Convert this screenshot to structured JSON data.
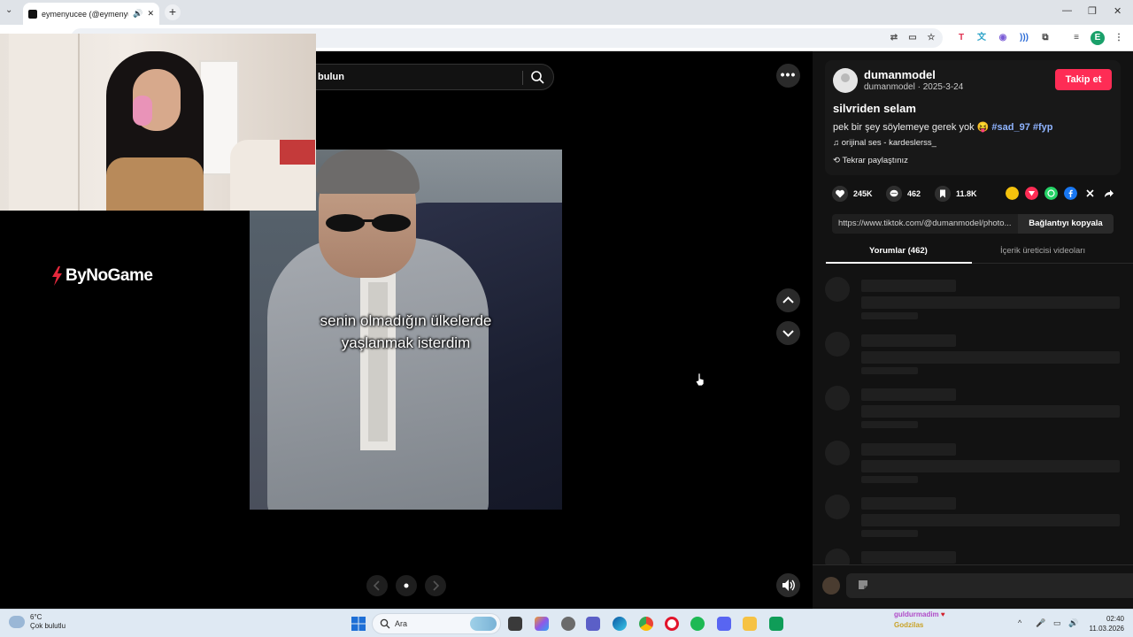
{
  "browser": {
    "tab_title": "eymenyucee (@eymenyucee)",
    "new_tab": "+",
    "window": {
      "minimize": "—",
      "restore": "❐",
      "close": "✕"
    }
  },
  "search": {
    "text": "bulun"
  },
  "more_button": "•••",
  "photo": {
    "caption_line1": "senin olmadığın ülkelerde",
    "caption_line2": "yaşlanmak isterdim"
  },
  "watermark": "ByNoGame",
  "post": {
    "username": "dumanmodel",
    "handle_date": "dumanmodel · 2025-3-24",
    "follow_label": "Takip et",
    "title": "silvriden selam",
    "description": "pek bir şey söylemeye gerek yok 😝",
    "hashtags": [
      "#sad_97",
      "#fyp"
    ],
    "music": "♫  orijinal ses - kardeslerss_",
    "repost": "Tekrar paylaştınız"
  },
  "actions": {
    "likes": "245K",
    "comments": "462",
    "saves": "11.8K"
  },
  "share_colors": [
    "#f4c20d",
    "#fe2c55",
    "#25d366",
    "#1877f2",
    "#000000"
  ],
  "link": {
    "url": "https://www.tiktok.com/@dumanmodel/photo...",
    "copy_label": "Bağlantıyı kopyala"
  },
  "tabs": {
    "comments": "Yorumlar (462)",
    "creator_videos": "İçerik üreticisi videoları"
  },
  "taskbar": {
    "weather_temp": "6°C",
    "weather_desc": "Çok bulutlu",
    "search_label": "Ara",
    "stream_line1": "guldurmadim",
    "stream_line2": "Godzilas",
    "time": "02:40",
    "date": "11.03.2026"
  }
}
